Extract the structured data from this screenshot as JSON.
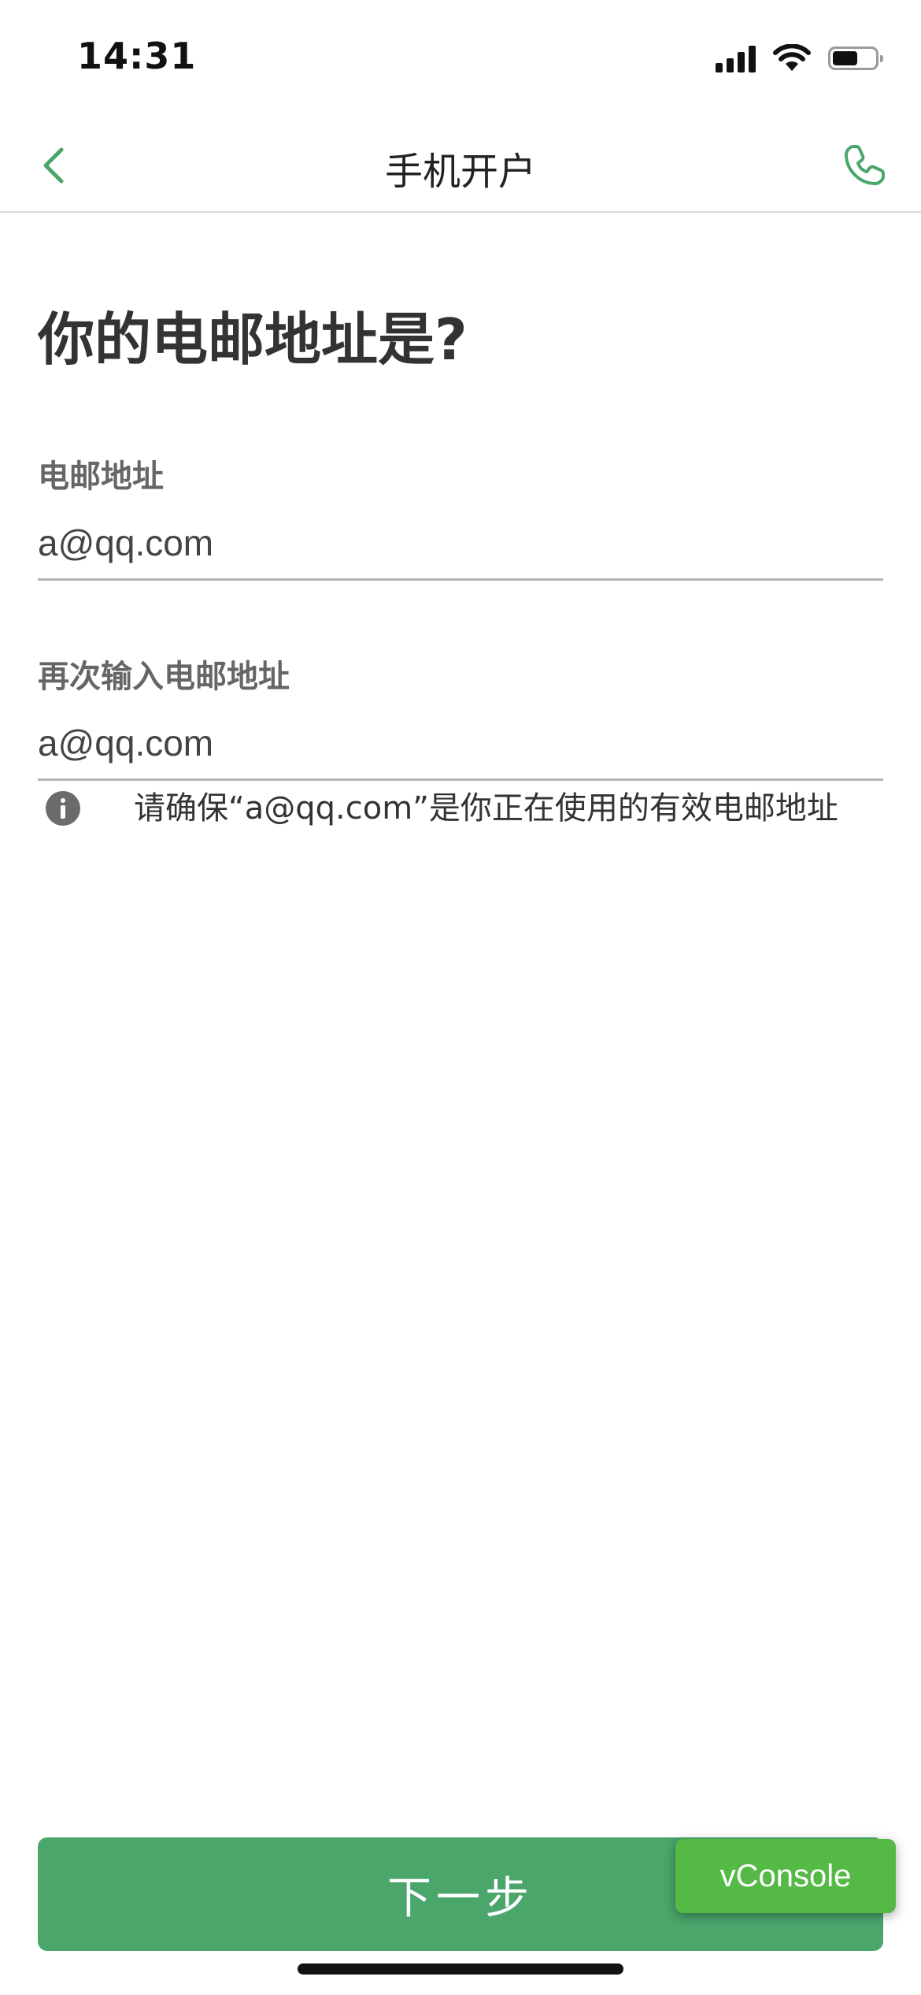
{
  "status_bar": {
    "time": "14:31",
    "icons": [
      "signal-icon",
      "wifi-icon",
      "battery-icon"
    ],
    "battery_level": 0.6
  },
  "nav": {
    "title": "手机开户",
    "back_icon": "chevron-left-icon",
    "phone_icon": "phone-icon",
    "accent_color": "#4aa66b"
  },
  "page": {
    "heading": "你的电邮地址是?"
  },
  "form": {
    "email": {
      "label": "电邮地址",
      "value": "a@qq.com"
    },
    "email_confirm": {
      "label": "再次输入电邮地址",
      "value": "a@qq.com"
    },
    "hint": {
      "icon": "info-icon",
      "text": "请确保“a@qq.com”是你正在使用的有效电邮地址"
    }
  },
  "actions": {
    "next_label": "下一步",
    "button_color": "#4aa66b"
  },
  "vconsole": {
    "label": "vConsole",
    "color": "#55b946"
  }
}
